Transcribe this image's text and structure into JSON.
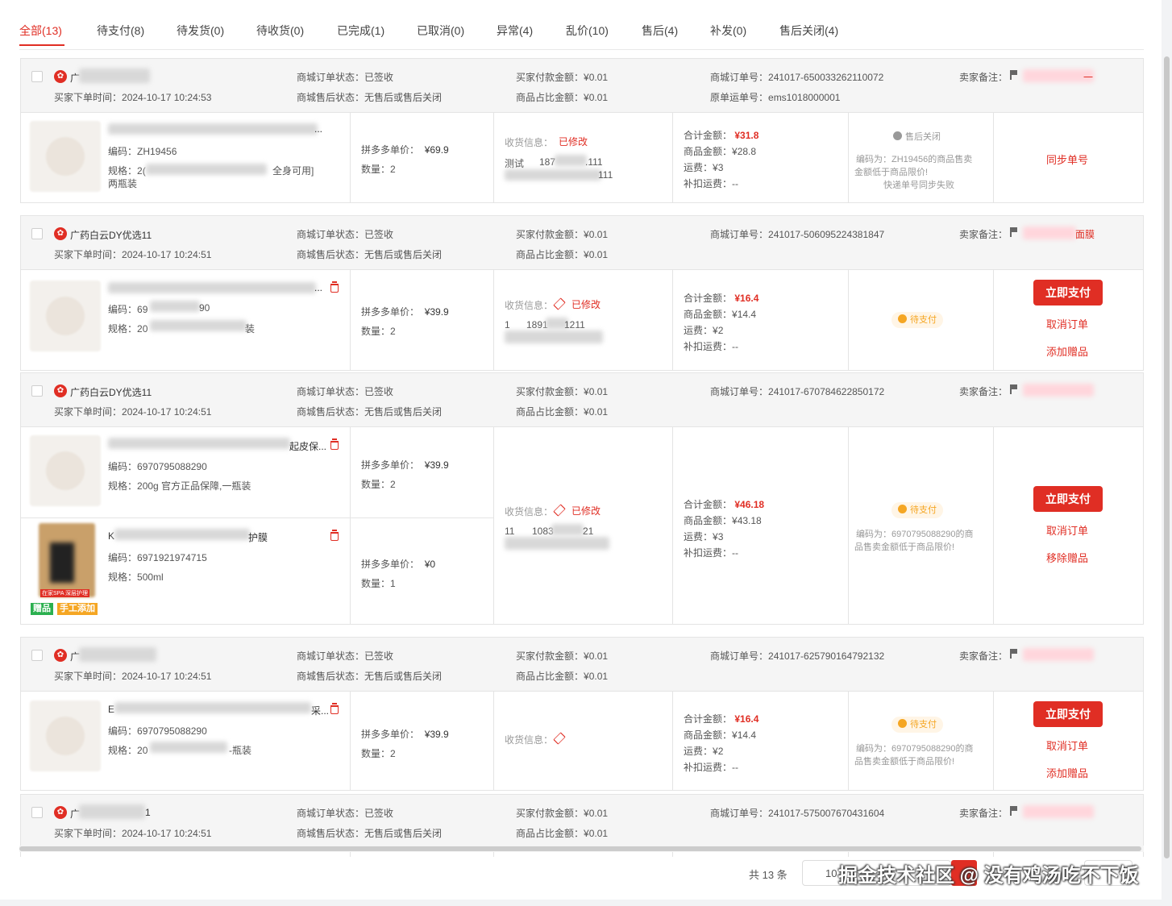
{
  "tabs": [
    "全部(13)",
    "待支付(8)",
    "待发货(0)",
    "待收货(0)",
    "已完成(1)",
    "已取消(0)",
    "异常(4)",
    "乱价(10)",
    "售后(4)",
    "补发(0)",
    "售后关闭(4)"
  ],
  "labels": {
    "order_time": "买家下单时间：",
    "mall_status": "商城订单状态：",
    "after_status": "商城售后状态：",
    "buyer_paid": "买家付款金额：",
    "share_amount": "商品占比金额：",
    "mall_order_no": "商城订单号：",
    "orig_waybill": "原单运单号：",
    "seller_note": "卖家备注：",
    "code": "编码：",
    "spec": "规格：",
    "unit_price": "拼多多单价：",
    "qty": "数量：",
    "recv_info": "收货信息：",
    "modified": "已修改",
    "total": "合计金额：",
    "goods_amount": "商品金额：",
    "freight": "运费：",
    "deduct_freight": "补扣运费：",
    "signed": "已签收",
    "no_after": "无售后或售后关闭",
    "amount_001": "¥0.01"
  },
  "actions": {
    "pay_now": "立即支付",
    "cancel_order": "取消订单",
    "add_gift": "添加赠品",
    "remove_gift": "移除赠品",
    "sync_no": "同步单号"
  },
  "orders": [
    {
      "shop": "广",
      "time": "2024-10-17 10:24:53",
      "order_no": "241017-650033262110072",
      "waybill": "ems1018000001",
      "note": "一",
      "items": [
        {
          "title": "...",
          "code": "ZH19456",
          "spec_a": "2(",
          "spec_b": "全身可用]",
          "spec_c": "两瓶装",
          "price": "¥69.9",
          "qty": "2"
        }
      ],
      "recv_name": "测试",
      "recv_phone_a": "187",
      "recv_phone_b": ".111",
      "recv_addr": "111",
      "total": "¥31.8",
      "goods": "¥28.8",
      "freight": "¥3",
      "deduct": "--",
      "status": "售后关闭",
      "msg_1": "编码为：ZH19456的商品售卖",
      "msg_2": "金额低于商品限价!",
      "msg_3": "快递单号同步失败"
    },
    {
      "shop": "广药白云DY优选11",
      "time": "2024-10-17 10:24:51",
      "order_no": "241017-506095224381847",
      "note": "面膜",
      "items": [
        {
          "title": "...",
          "code_a": "69",
          "code_b": "90",
          "spec_a": "20",
          "spec_b": "装",
          "price": "¥39.9",
          "qty": "2"
        }
      ],
      "recv_a": "1",
      "recv_b": "1891",
      "recv_c": "1211",
      "total": "¥16.4",
      "goods": "¥14.4",
      "freight": "¥2",
      "deduct": "--",
      "status": "待支付"
    },
    {
      "shop": "广药白云DY优选11",
      "time": "2024-10-17 10:24:51",
      "order_no": "241017-670784622850172",
      "note": "",
      "items": [
        {
          "title": "起皮保...",
          "code": "6970795088290",
          "spec": "200g 官方正品保障,一瓶装",
          "price": "¥39.9",
          "qty": "2"
        },
        {
          "title": "K",
          "title_b": "护膜",
          "code": "6971921974715",
          "spec": "500ml",
          "price": "¥0",
          "qty": "1",
          "badge_gift": "赠品",
          "badge_manual": "手工添加",
          "img_caption": "在家SPA 深层护理"
        }
      ],
      "recv_a": "11",
      "recv_b": "1083",
      "recv_c": "21",
      "total": "¥46.18",
      "goods": "¥43.18",
      "freight": "¥3",
      "deduct": "--",
      "status": "待支付",
      "msg_1": "编码为：6970795088290的商",
      "msg_2": "品售卖金额低于商品限价!"
    },
    {
      "shop": "广",
      "time": "2024-10-17 10:24:51",
      "order_no": "241017-625790164792132",
      "note": "",
      "items": [
        {
          "title": "E",
          "title_b": "采...",
          "code": "6970795088290",
          "spec_a": "20",
          "spec_b": "-瓶装",
          "price": "¥39.9",
          "qty": "2"
        }
      ],
      "total": "¥16.4",
      "goods": "¥14.4",
      "freight": "¥2",
      "deduct": "--",
      "status": "待支付",
      "msg_1": "编码为：6970795088290的商",
      "msg_2": "品售卖金额低于商品限价!"
    },
    {
      "shop": "广",
      "shop_tail": "1",
      "time": "2024-10-17 10:24:51",
      "order_no": "241017-575007670431604",
      "note": ""
    }
  ],
  "footer": {
    "total_text": "共 13 条",
    "page_size": "10",
    "watermark": "掘金技术社区 @ 没有鸡汤吃不下饭"
  },
  "colors": {
    "accent": "#e02e24",
    "pending": "#f5a623",
    "header_bg": "#f5f5f5"
  }
}
